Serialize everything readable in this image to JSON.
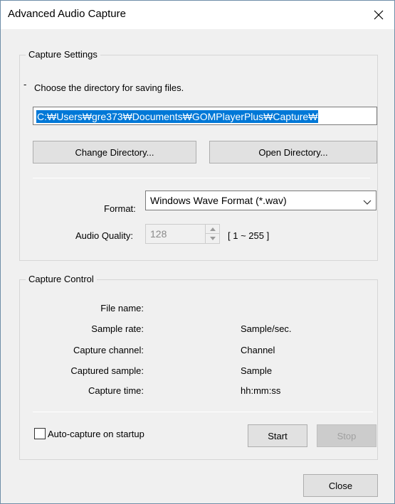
{
  "window": {
    "title": "Advanced Audio Capture",
    "close_glyph": "✕"
  },
  "capture_settings": {
    "legend": "Capture Settings",
    "hint_dash": "-",
    "hint": "Choose the directory for saving files.",
    "path": "C:\\Users\\gre373\\Documents\\GOMPlayerPlus\\Capture\\",
    "path_display": "C:₩Users₩gre373₩Documents₩GOMPlayerPlus₩Capture₩",
    "change_dir_label": "Change Directory...",
    "open_dir_label": "Open Directory...",
    "format_label": "Format:",
    "format_value": "Windows Wave Format (*.wav)",
    "quality_label": "Audio Quality:",
    "quality_value": "128",
    "quality_range": "[ 1 ~ 255 ]"
  },
  "capture_control": {
    "legend": "Capture Control",
    "fields": [
      {
        "label": "File name:",
        "unit": ""
      },
      {
        "label": "Sample rate:",
        "unit": "Sample/sec."
      },
      {
        "label": "Capture channel:",
        "unit": "Channel"
      },
      {
        "label": "Captured sample:",
        "unit": "Sample"
      },
      {
        "label": "Capture time:",
        "unit": "hh:mm:ss"
      }
    ],
    "auto_capture_label": "Auto-capture on startup",
    "auto_capture_checked": false,
    "start_label": "Start",
    "stop_label": "Stop"
  },
  "footer": {
    "close_label": "Close"
  },
  "icons": {
    "close": "close-icon",
    "dropdown": "chevron-down-icon",
    "spin_up": "spin-up-arrow-icon",
    "spin_down": "spin-down-arrow-icon"
  },
  "colors": {
    "selection": "#0078d7",
    "window_bg": "#f0f0f0",
    "border": "#6f8ea8"
  }
}
